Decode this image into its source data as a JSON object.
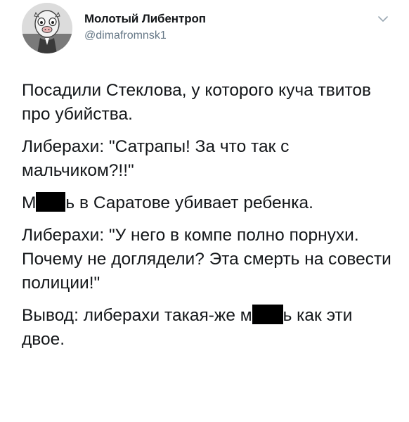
{
  "tweet": {
    "author": {
      "display_name": "Молотый Либентроп",
      "handle": "@dimafromnsk1",
      "avatar_icon": "avatar-image"
    },
    "menu_icon": "chevron-down-icon",
    "text": {
      "p1": "Посадили Стеклова, у которого куча твитов про убийства.",
      "p2": "Либерахи: \"Сатрапы! За что так с мальчиком?!!\"",
      "p3_before": "М",
      "p3_after": "ь в Саратове убивает ребенка.",
      "p4": "Либерахи: \"У него в компе полно порнухи. Почему не доглядели? Эта смерть на совести полиции!\"",
      "p5_before": "Вывод: либерахи такая-же м",
      "p5_after": "ь как эти двое."
    },
    "colors": {
      "text": "#14171a",
      "secondary": "#657786",
      "redaction": "#000000"
    }
  }
}
